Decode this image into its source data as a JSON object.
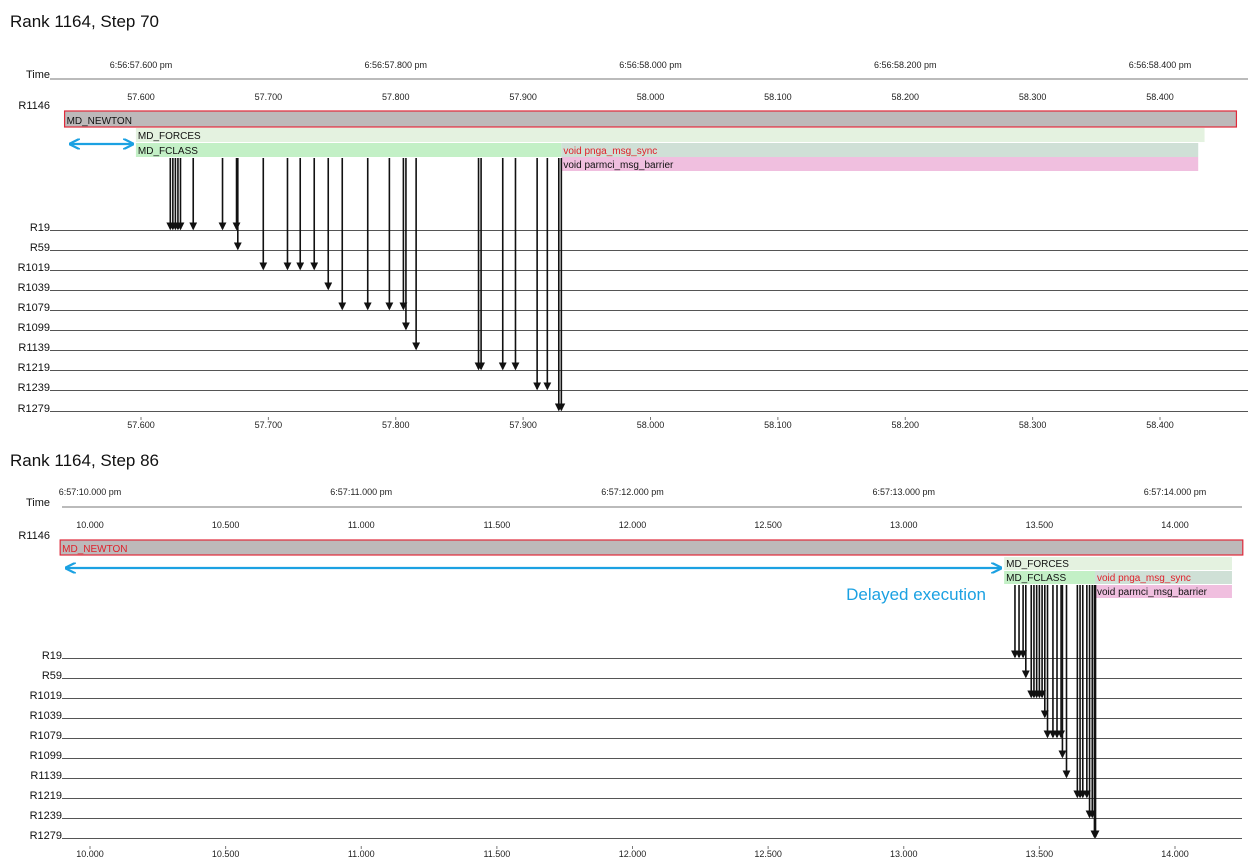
{
  "colors": {
    "annotation": "#1ba1e2",
    "newton_fill": "#bdb9ba",
    "newton_border": "#e0293a",
    "forces_fill": "#e4f2e0",
    "fclass_fill": "#c3f0c6",
    "sync_fill": "#cfe0d6",
    "barrier_fill": "#f0bfdf",
    "rank_line": "#555555",
    "message": "#111111",
    "red_text": "#e0202a"
  },
  "row_labels": [
    "R19",
    "R59",
    "R1019",
    "R1039",
    "R1079",
    "R1099",
    "R1139",
    "R1219",
    "R1239",
    "R1279"
  ],
  "panels": [
    {
      "title": "Rank 1164, Step 70",
      "time_label": "Time",
      "self_rank_label": "R1146",
      "top_ticks": [
        {
          "value": 57.6,
          "label": "6:56:57.600 pm"
        },
        {
          "value": 57.8,
          "label": "6:56:57.800 pm"
        },
        {
          "value": 58.0,
          "label": "6:56:58.000 pm"
        },
        {
          "value": 58.2,
          "label": "6:56:58.200 pm"
        },
        {
          "value": 58.4,
          "label": "6:56:58.400 pm"
        }
      ],
      "ticks": [
        {
          "value": 57.6,
          "label": "57.600"
        },
        {
          "value": 57.7,
          "label": "57.700"
        },
        {
          "value": 57.8,
          "label": "57.800"
        },
        {
          "value": 57.9,
          "label": "57.900"
        },
        {
          "value": 58.0,
          "label": "58.000"
        },
        {
          "value": 58.1,
          "label": "58.100"
        },
        {
          "value": 58.2,
          "label": "58.200"
        },
        {
          "value": 58.3,
          "label": "58.300"
        },
        {
          "value": 58.4,
          "label": "58.400"
        }
      ],
      "functions": [
        {
          "name": "MD_NEWTON",
          "level": 0,
          "start": 57.54,
          "end": 58.46,
          "style": "newton",
          "label_color": "black"
        },
        {
          "name": "MD_FORCES",
          "level": 1,
          "start": 57.596,
          "end": 58.435,
          "style": "forces",
          "label_color": "black"
        },
        {
          "name": "MD_FCLASS",
          "level": 2,
          "start": 57.596,
          "end": 57.93,
          "style": "fclass",
          "label_color": "black"
        },
        {
          "name": "void pnga_msg_sync",
          "level": 2,
          "start": 57.93,
          "end": 58.43,
          "style": "sync",
          "label_color": "red"
        },
        {
          "name": "void parmci_msg_barrier",
          "level": 3,
          "start": 57.93,
          "end": 58.43,
          "style": "barrier",
          "label_color": "black"
        }
      ],
      "annotation": {
        "start": 57.542,
        "end": 57.596,
        "text": ""
      },
      "messages": [
        {
          "t": 57.623,
          "row": 0
        },
        {
          "t": 57.625,
          "row": 0
        },
        {
          "t": 57.627,
          "row": 0
        },
        {
          "t": 57.629,
          "row": 0
        },
        {
          "t": 57.631,
          "row": 0
        },
        {
          "t": 57.641,
          "row": 0
        },
        {
          "t": 57.664,
          "row": 0
        },
        {
          "t": 57.675,
          "row": 0
        },
        {
          "t": 57.676,
          "row": 1
        },
        {
          "t": 57.696,
          "row": 2
        },
        {
          "t": 57.715,
          "row": 2
        },
        {
          "t": 57.725,
          "row": 2
        },
        {
          "t": 57.736,
          "row": 2
        },
        {
          "t": 57.747,
          "row": 3
        },
        {
          "t": 57.758,
          "row": 4
        },
        {
          "t": 57.778,
          "row": 4
        },
        {
          "t": 57.795,
          "row": 4
        },
        {
          "t": 57.806,
          "row": 4
        },
        {
          "t": 57.808,
          "row": 5
        },
        {
          "t": 57.816,
          "row": 6
        },
        {
          "t": 57.865,
          "row": 7
        },
        {
          "t": 57.867,
          "row": 7
        },
        {
          "t": 57.884,
          "row": 7
        },
        {
          "t": 57.894,
          "row": 7
        },
        {
          "t": 57.911,
          "row": 8
        },
        {
          "t": 57.919,
          "row": 8
        },
        {
          "t": 57.928,
          "row": 9
        },
        {
          "t": 57.93,
          "row": 9
        }
      ]
    },
    {
      "title": "Rank 1164, Step 86",
      "time_label": "Time",
      "self_rank_label": "R1146",
      "top_ticks": [
        {
          "value": 10.0,
          "label": "6:57:10.000 pm"
        },
        {
          "value": 11.0,
          "label": "6:57:11.000 pm"
        },
        {
          "value": 12.0,
          "label": "6:57:12.000 pm"
        },
        {
          "value": 13.0,
          "label": "6:57:13.000 pm"
        },
        {
          "value": 14.0,
          "label": "6:57:14.000 pm"
        }
      ],
      "ticks": [
        {
          "value": 10.0,
          "label": "10.000"
        },
        {
          "value": 10.5,
          "label": "10.500"
        },
        {
          "value": 11.0,
          "label": "11.000"
        },
        {
          "value": 11.5,
          "label": "11.500"
        },
        {
          "value": 12.0,
          "label": "12.000"
        },
        {
          "value": 12.5,
          "label": "12.500"
        },
        {
          "value": 13.0,
          "label": "13.000"
        },
        {
          "value": 13.5,
          "label": "13.500"
        },
        {
          "value": 14.0,
          "label": "14.000"
        }
      ],
      "functions": [
        {
          "name": "MD_NEWTON",
          "level": 0,
          "start": 9.89,
          "end": 14.25,
          "style": "newton",
          "label_color": "red"
        },
        {
          "name": "MD_FORCES",
          "level": 1,
          "start": 13.37,
          "end": 14.21,
          "style": "forces",
          "label_color": "black"
        },
        {
          "name": "MD_FCLASS",
          "level": 2,
          "start": 13.37,
          "end": 13.705,
          "style": "fclass",
          "label_color": "black"
        },
        {
          "name": "void pnga_msg_sync",
          "level": 2,
          "start": 13.705,
          "end": 14.21,
          "style": "sync",
          "label_color": "red"
        },
        {
          "name": "void parmci_msg_barrier",
          "level": 3,
          "start": 13.705,
          "end": 14.21,
          "style": "barrier",
          "label_color": "black"
        }
      ],
      "annotation": {
        "start": 9.9,
        "end": 13.37,
        "text": "Delayed execution"
      },
      "messages": [
        {
          "t": 13.41,
          "row": 0
        },
        {
          "t": 13.425,
          "row": 0
        },
        {
          "t": 13.44,
          "row": 0
        },
        {
          "t": 13.45,
          "row": 1
        },
        {
          "t": 13.47,
          "row": 2
        },
        {
          "t": 13.48,
          "row": 2
        },
        {
          "t": 13.49,
          "row": 2
        },
        {
          "t": 13.5,
          "row": 2
        },
        {
          "t": 13.51,
          "row": 2
        },
        {
          "t": 13.52,
          "row": 3
        },
        {
          "t": 13.53,
          "row": 4
        },
        {
          "t": 13.55,
          "row": 4
        },
        {
          "t": 13.565,
          "row": 4
        },
        {
          "t": 13.58,
          "row": 4
        },
        {
          "t": 13.585,
          "row": 5
        },
        {
          "t": 13.6,
          "row": 6
        },
        {
          "t": 13.64,
          "row": 7
        },
        {
          "t": 13.65,
          "row": 7
        },
        {
          "t": 13.66,
          "row": 7
        },
        {
          "t": 13.675,
          "row": 7
        },
        {
          "t": 13.685,
          "row": 8
        },
        {
          "t": 13.695,
          "row": 8
        },
        {
          "t": 13.703,
          "row": 9
        },
        {
          "t": 13.707,
          "row": 9
        }
      ]
    }
  ]
}
